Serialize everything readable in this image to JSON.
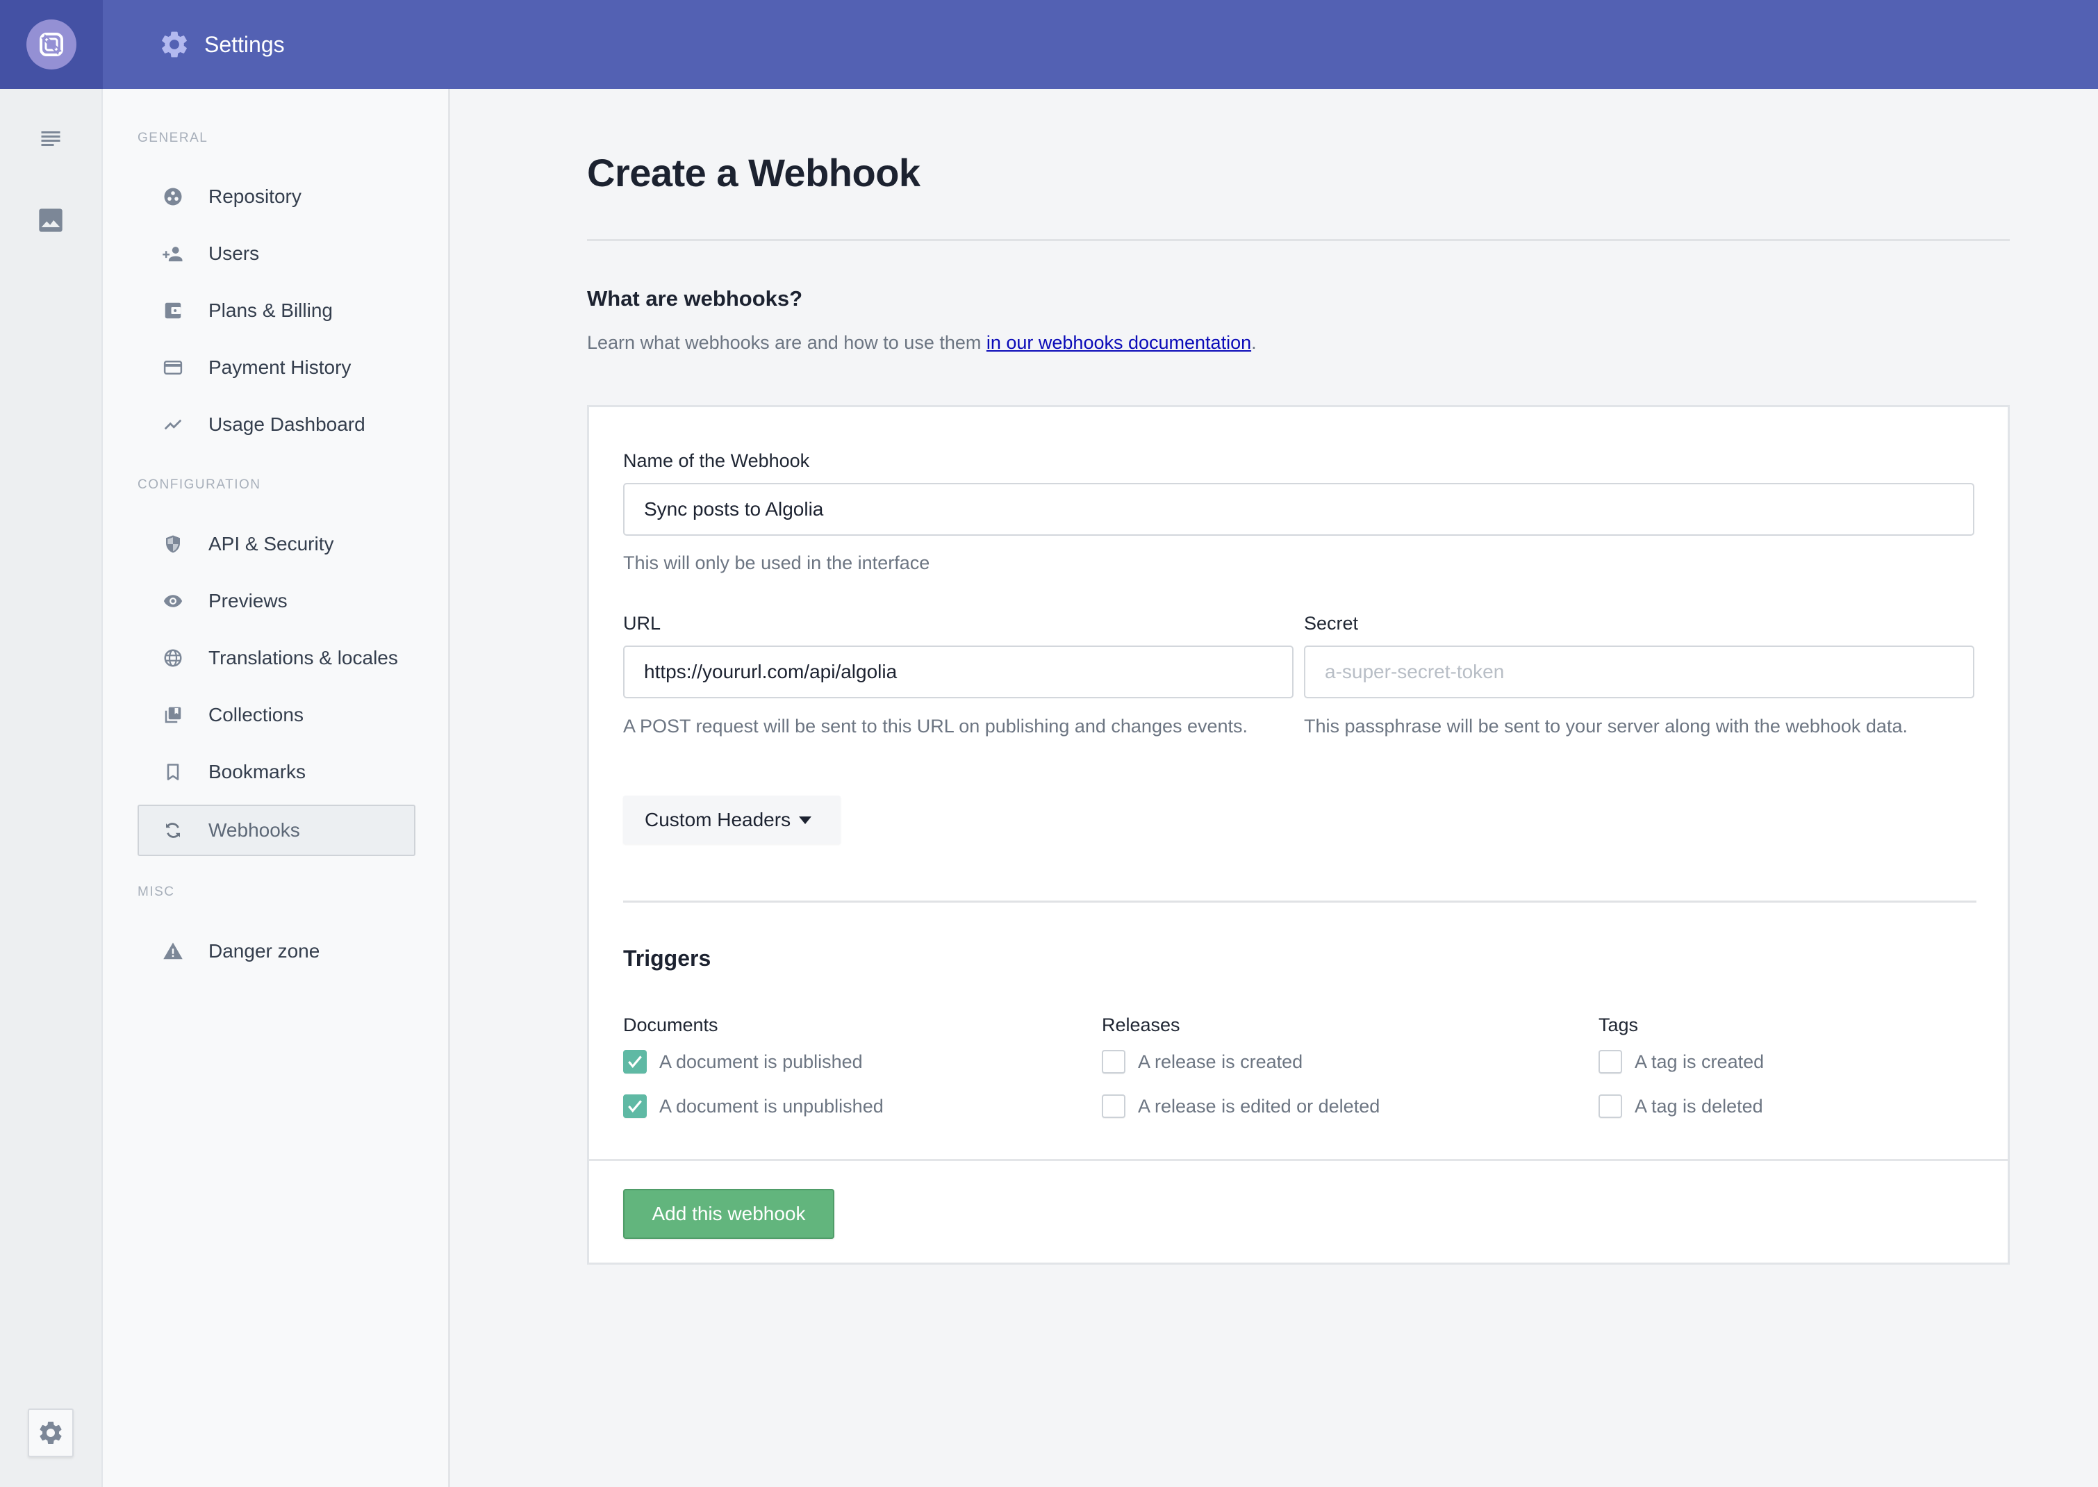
{
  "header": {
    "title": "Settings",
    "logo_icon": "prismic-logo-icon",
    "title_icon": "gear-icon",
    "colors": {
      "bar": "#5361b3",
      "rail": "#4451a4",
      "logo_bg": "#9490d4"
    }
  },
  "rail": {
    "items": [
      {
        "icon": "document-list-icon",
        "label": "Documents"
      },
      {
        "icon": "image-icon",
        "label": "Media library"
      }
    ],
    "settings_icon": "gear-icon"
  },
  "sidebar": {
    "sections": [
      {
        "label": "General",
        "items": [
          {
            "label": "Repository",
            "icon": "repository-icon"
          },
          {
            "label": "Users",
            "icon": "add-user-icon"
          },
          {
            "label": "Plans & Billing",
            "icon": "wallet-icon"
          },
          {
            "label": "Payment History",
            "icon": "credit-card-icon"
          },
          {
            "label": "Usage Dashboard",
            "icon": "trend-chart-icon"
          }
        ]
      },
      {
        "label": "Configuration",
        "items": [
          {
            "label": "API & Security",
            "icon": "shield-icon"
          },
          {
            "label": "Previews",
            "icon": "eye-icon"
          },
          {
            "label": "Translations & locales",
            "icon": "globe-icon"
          },
          {
            "label": "Collections",
            "icon": "collections-icon"
          },
          {
            "label": "Bookmarks",
            "icon": "bookmark-icon"
          },
          {
            "label": "Webhooks",
            "icon": "sync-icon",
            "active": true
          }
        ]
      },
      {
        "label": "Misc",
        "items": [
          {
            "label": "Danger zone",
            "icon": "warning-icon"
          }
        ]
      }
    ]
  },
  "main": {
    "title": "Create a Webhook",
    "intro": {
      "heading": "What are webhooks?",
      "text_before": "Learn what webhooks are and how to use them ",
      "link_text": "in our webhooks documentation",
      "text_after": "."
    },
    "form": {
      "name": {
        "label": "Name of the Webhook",
        "value": "Sync posts to Algolia",
        "help": "This will only be used in the interface"
      },
      "url": {
        "label": "URL",
        "value": "https://yoururl.com/api/algolia",
        "help": "A POST request will be sent to this URL on publishing and changes events."
      },
      "secret": {
        "label": "Secret",
        "value": "",
        "placeholder": "a-super-secret-token",
        "help": "This passphrase will be sent to your server along with the webhook data."
      },
      "custom_headers_label": "Custom Headers",
      "triggers": {
        "title": "Triggers",
        "groups": [
          {
            "title": "Documents",
            "options": [
              {
                "label": "A document is published",
                "checked": true
              },
              {
                "label": "A document is unpublished",
                "checked": true
              }
            ]
          },
          {
            "title": "Releases",
            "options": [
              {
                "label": "A release is created",
                "checked": false
              },
              {
                "label": "A release is edited or deleted",
                "checked": false
              }
            ]
          },
          {
            "title": "Tags",
            "options": [
              {
                "label": "A tag is created",
                "checked": false
              },
              {
                "label": "A tag is deleted",
                "checked": false
              }
            ]
          }
        ]
      },
      "submit_label": "Add this webhook",
      "colors": {
        "checkbox_checked": "#5fb9a4",
        "submit": "#62b57d",
        "link": "#0a0ab8"
      }
    }
  }
}
